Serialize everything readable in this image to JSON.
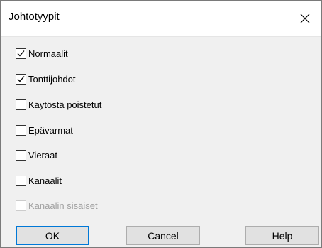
{
  "dialog": {
    "title": "Johtotyypit"
  },
  "options": [
    {
      "label": "Normaalit",
      "checked": true,
      "enabled": true
    },
    {
      "label": "Tonttijohdot",
      "checked": true,
      "enabled": true
    },
    {
      "label": "Käytöstä poistetut",
      "checked": false,
      "enabled": true
    },
    {
      "label": "Epävarmat",
      "checked": false,
      "enabled": true
    },
    {
      "label": "Vieraat",
      "checked": false,
      "enabled": true
    },
    {
      "label": "Kanaalit",
      "checked": false,
      "enabled": true
    },
    {
      "label": "Kanaalin sisäiset",
      "checked": false,
      "enabled": false
    }
  ],
  "buttons": {
    "ok": "OK",
    "cancel": "Cancel",
    "help": "Help"
  },
  "colors": {
    "accent": "#0078d7",
    "disabled_text": "#a0a0a0"
  }
}
